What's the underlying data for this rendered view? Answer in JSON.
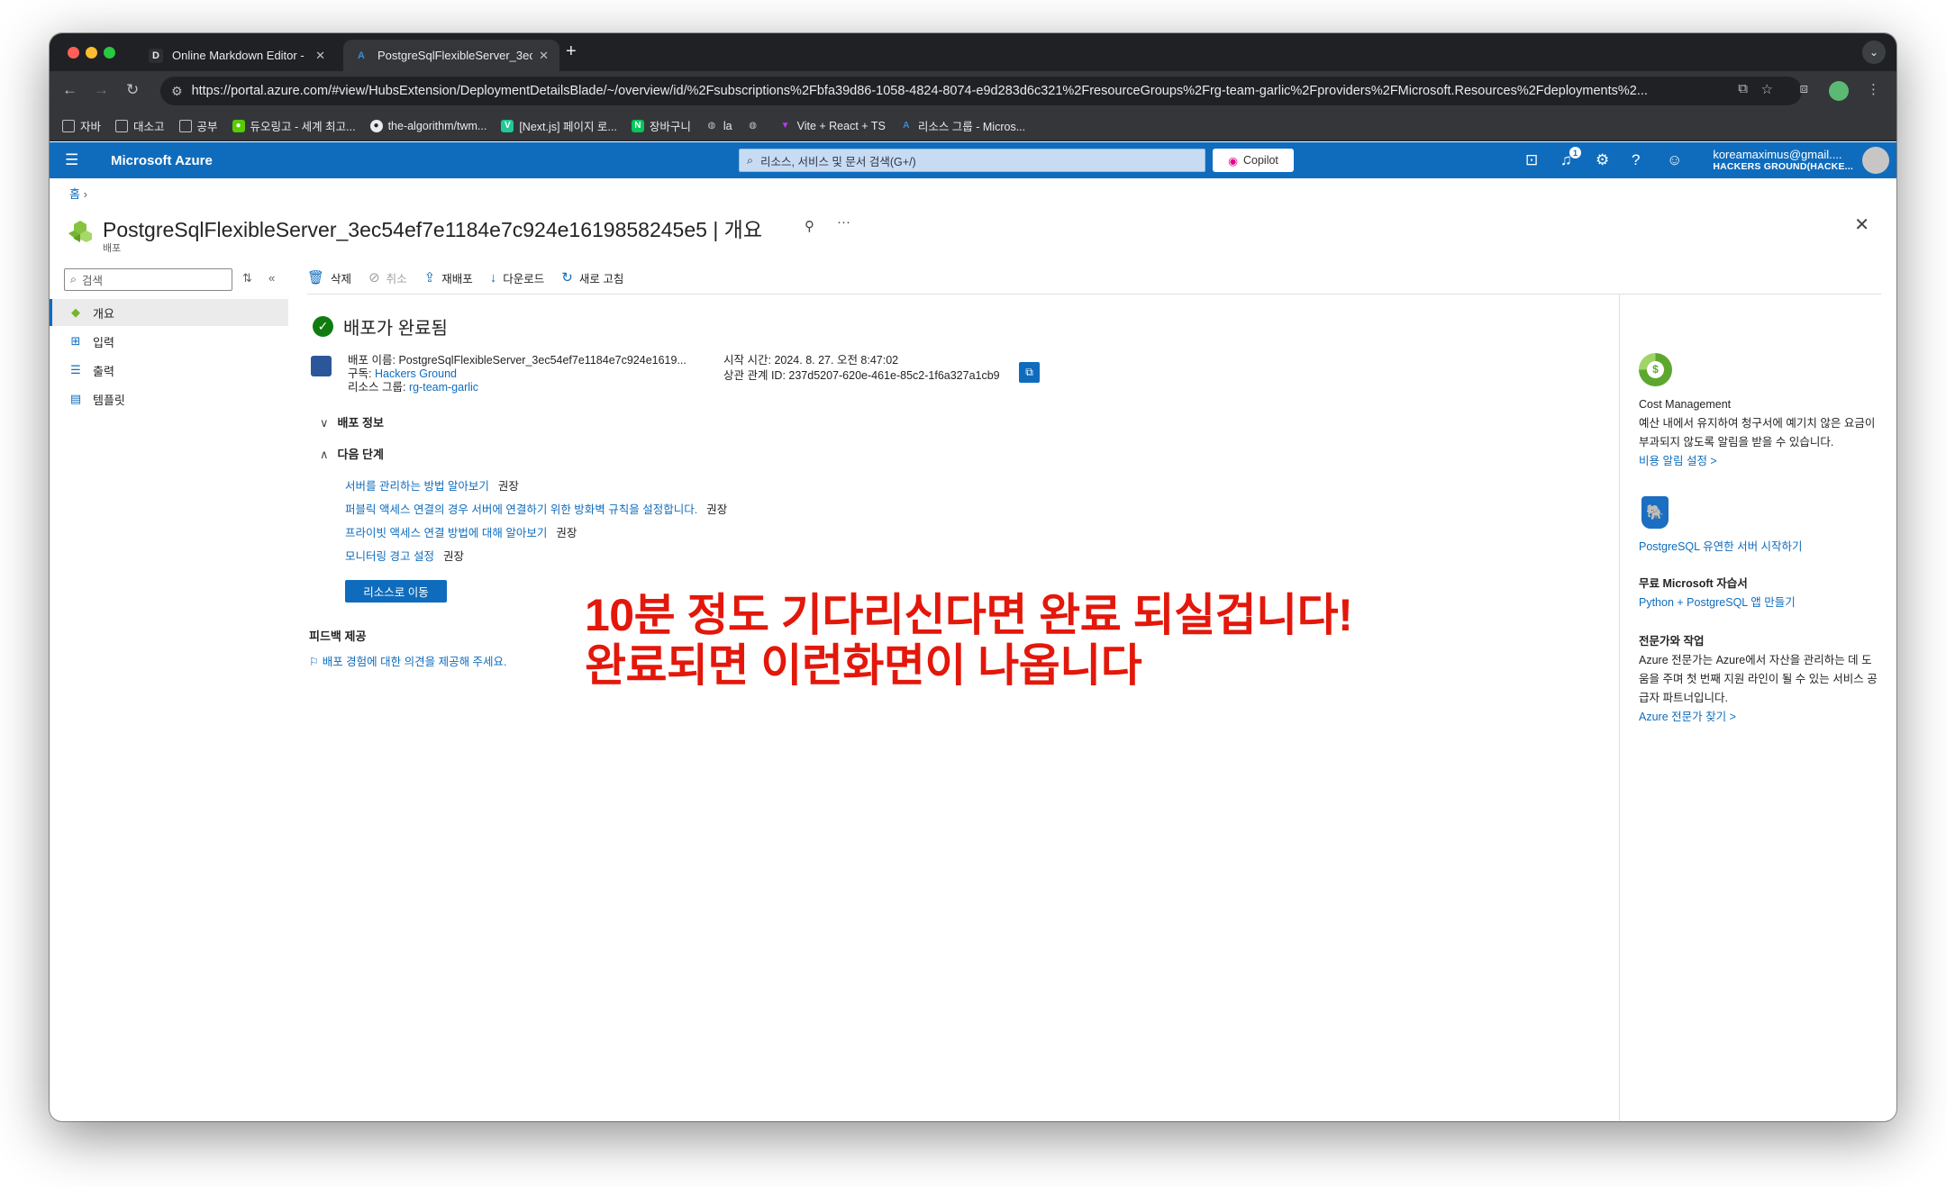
{
  "browser": {
    "tabs": [
      {
        "title": "Online Markdown Editor - Dilli",
        "favicon": "D"
      },
      {
        "title": "PostgreSqlFlexibleServer_3ec",
        "favicon": "A"
      }
    ],
    "url": "https://portal.azure.com/#view/HubsExtension/DeploymentDetailsBlade/~/overview/id/%2Fsubscriptions%2Fbfa39d86-1058-4824-8074-e9d283d6c321%2FresourceGroups%2Frg-team-garlic%2Fproviders%2FMicrosoft.Resources%2Fdeployments%2...",
    "bookmarks": [
      "자바",
      "대소고",
      "공부",
      "듀오링고 - 세계 최고...",
      "the-algorithm/twm...",
      "[Next.js] 페이지 로...",
      "장바구니",
      "la",
      "",
      "Vite + React + TS",
      "리소스 그룹 - Micros..."
    ]
  },
  "azure": {
    "brand": "Microsoft Azure",
    "search_placeholder": "리소스, 서비스 및 문서 검색(G+/)",
    "copilot": "Copilot",
    "notif_count": "1",
    "account_email": "koreamaximus@gmail....",
    "account_tenant": "HACKERS GROUND(HACKE..."
  },
  "page": {
    "breadcrumb": "홈",
    "title": "PostgreSqlFlexibleServer_3ec54ef7e1184e7c924e1619858245e5 | 개요",
    "subtitle": "배포"
  },
  "leftnav": {
    "search_placeholder": "검색",
    "items": [
      {
        "label": "개요",
        "icon": "deployment-icon"
      },
      {
        "label": "입력",
        "icon": "input-icon"
      },
      {
        "label": "출력",
        "icon": "output-icon"
      },
      {
        "label": "템플릿",
        "icon": "template-icon"
      }
    ]
  },
  "toolbar": {
    "delete": "삭제",
    "cancel": "취소",
    "redeploy": "재배포",
    "download": "다운로드",
    "refresh": "새로 고침"
  },
  "status": {
    "title": "배포가 완료됨",
    "deployment_name_label": "배포 이름:",
    "deployment_name": "PostgreSqlFlexibleServer_3ec54ef7e1184e7c924e1619...",
    "subscription_label": "구독:",
    "subscription": "Hackers Ground",
    "resource_group_label": "리소스 그룹:",
    "resource_group": "rg-team-garlic",
    "start_time_label": "시작 시간:",
    "start_time": "2024. 8. 27. 오전 8:47:02",
    "correlation_label": "상관 관계 ID:",
    "correlation_id": "237d5207-620e-461e-85c2-1f6a327a1cb9"
  },
  "sections": {
    "deploy_info": "배포 정보",
    "next_steps": "다음 단계",
    "steps": [
      {
        "link": "서버를 관리하는 방법 알아보기",
        "tag": "권장"
      },
      {
        "link": "퍼블릭 액세스 연결의 경우 서버에 연결하기 위한 방화벽 규칙을 설정합니다.",
        "tag": "권장"
      },
      {
        "link": "프라이빗 액세스 연결 방법에 대해 알아보기",
        "tag": "권장"
      },
      {
        "link": "모니터링 경고 설정",
        "tag": "권장"
      }
    ],
    "go_resource": "리소스로 이동",
    "feedback_title": "피드백 제공",
    "feedback_link": "배포 경험에 대한 의견을 제공해 주세요."
  },
  "annotation": {
    "line1": "10분 정도 기다리신다면 완료 되실겁니다!",
    "line2": "완료되면 이런화면이 나옵니다"
  },
  "rightpanel": {
    "cost_title": "Cost Management",
    "cost_desc": "예산 내에서 유지하여 청구서에 예기치 않은 요금이 부과되지 않도록 알림을 받을 수 있습니다.",
    "cost_link": "비용 알림 설정 >",
    "pg_link": "PostgreSQL 유연한 서버 시작하기",
    "learn_title": "무료 Microsoft 자습서",
    "learn_link": "Python + PostgreSQL 앱 만들기",
    "expert_title": "전문가와 작업",
    "expert_desc": "Azure 전문가는 Azure에서 자산을 관리하는 데 도움을 주며 첫 번째 지원 라인이 될 수 있는 서비스 공급자 파트너입니다.",
    "expert_link": "Azure 전문가 찾기 >"
  }
}
